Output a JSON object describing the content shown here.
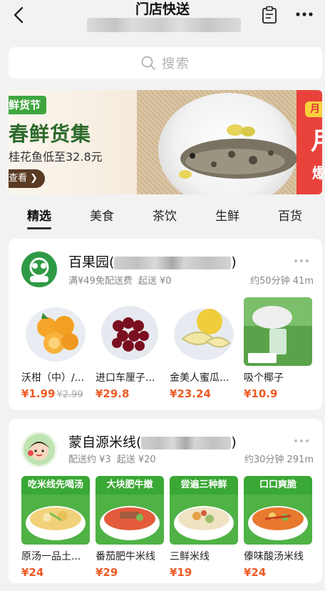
{
  "header": {
    "title": "门店快送"
  },
  "search": {
    "placeholder": "搜索"
  },
  "banner": {
    "tag": "鲜货节",
    "title": "春鲜货集",
    "subtitle": "桂花鱼低至32.8元",
    "button": "查看",
    "side_badge": "月",
    "side_big": "月",
    "side_small": "爆"
  },
  "tabs": [
    "精选",
    "美食",
    "茶饮",
    "生鲜",
    "百货"
  ],
  "stores": [
    {
      "name_visible": "百果园(",
      "name_close": ")",
      "avatar_label": "百果园",
      "meta": [
        "满¥49免配送费",
        "起送 ¥0"
      ],
      "eta": "约50分钟  41m",
      "products": [
        {
          "name": "沃柑（中）/...",
          "price": "¥1.99",
          "original": "¥2.99"
        },
        {
          "name": "进口车厘子...",
          "price": "¥29.8"
        },
        {
          "name": "金美人蜜瓜...",
          "price": "¥23.24"
        },
        {
          "name": "吸个椰子",
          "price": "¥10.9",
          "img_label": "吸个椰子"
        }
      ]
    },
    {
      "name_visible": "蒙自源米线(",
      "name_close": ")",
      "meta": [
        "配送约 ¥3",
        "起送 ¥20"
      ],
      "eta": "约30分钟  291m",
      "products": [
        {
          "name": "原汤一品土...",
          "price": "¥24",
          "banner": "吃米线先喝汤"
        },
        {
          "name": "番茄肥牛米线",
          "price": "¥29",
          "banner": "大块肥牛嫩"
        },
        {
          "name": "三鲜米线",
          "price": "¥19",
          "banner": "尝遍三种鲜"
        },
        {
          "name": "傣味酸汤米线",
          "price": "¥24",
          "banner": "口口爽脆"
        }
      ]
    }
  ],
  "colors": {
    "price": "#ee5a24",
    "banner_green": "#3fa63f",
    "banner_red": "#e8423b"
  }
}
